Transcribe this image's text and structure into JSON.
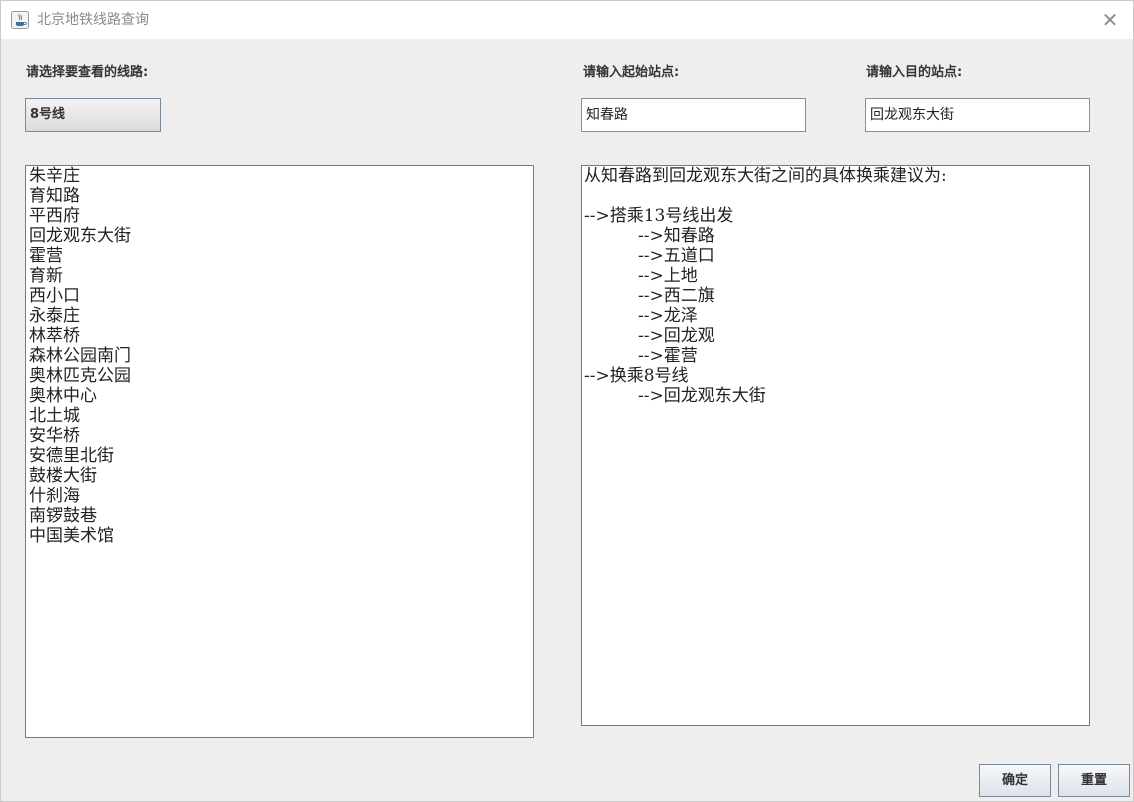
{
  "window": {
    "title": "北京地铁线路查询",
    "close_glyph": "✕"
  },
  "labels": {
    "line_select": "请选择要查看的线路:",
    "start_station": "请输入起始站点:",
    "end_station": "请输入目的站点:"
  },
  "line_select": {
    "value": "8号线"
  },
  "start_input": {
    "value": "知春路"
  },
  "end_input": {
    "value": "回龙观东大街"
  },
  "stations": [
    "朱辛庄",
    "育知路",
    "平西府",
    "回龙观东大街",
    "霍营",
    "育新",
    "西小口",
    "永泰庄",
    "林萃桥",
    "森林公园南门",
    "奥林匹克公园",
    "奥林中心",
    "北土城",
    "安华桥",
    "安德里北街",
    "鼓楼大街",
    "什刹海",
    "南锣鼓巷",
    "中国美术馆"
  ],
  "result": {
    "lines": [
      "从知春路到回龙观东大街之间的具体换乘建议为:",
      "",
      "-->搭乘13号线出发",
      "          -->知春路",
      "          -->五道口",
      "          -->上地",
      "          -->西二旗",
      "          -->龙泽",
      "          -->回龙观",
      "          -->霍营",
      "-->换乘8号线",
      "          -->回龙观东大街"
    ]
  },
  "buttons": {
    "confirm": "确定",
    "reset": "重置"
  },
  "icons": {
    "app": "java-icon",
    "close": "close-icon"
  }
}
